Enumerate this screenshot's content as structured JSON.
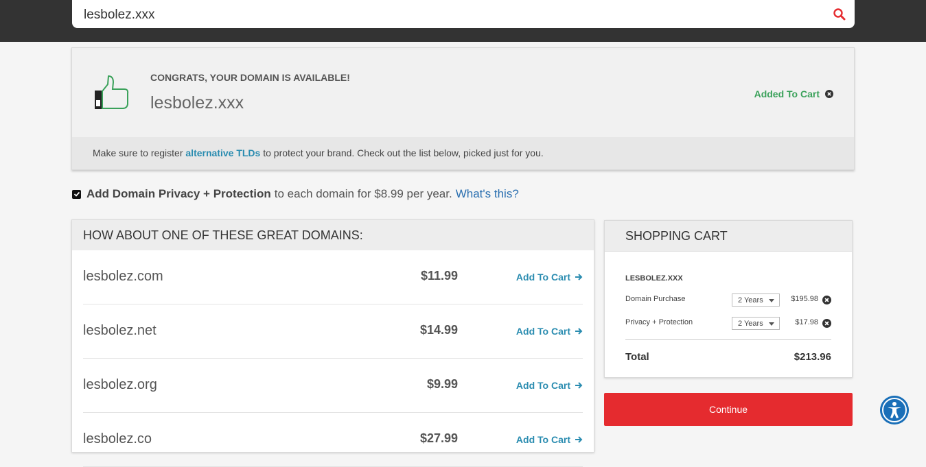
{
  "search": {
    "value": "lesbolez.xxx",
    "icon": "search-icon"
  },
  "congrats": {
    "heading": "CONGRATS, YOUR DOMAIN IS AVAILABLE!",
    "domain": "lesbolez.xxx",
    "added_label": "Added To Cart",
    "note_before": "Make sure to register ",
    "note_link": "alternative TLDs",
    "note_after": " to protect your brand. Check out the list below, picked just for you."
  },
  "privacy": {
    "checked": true,
    "bold": "Add Domain Privacy + Protection",
    "text": "to each domain for $8.99 per year.",
    "link": "What's this?"
  },
  "suggestions": {
    "title": "HOW ABOUT ONE OF THESE GREAT DOMAINS:",
    "add_label": "Add To Cart",
    "items": [
      {
        "name": "lesbolez.com",
        "price": "$11.99"
      },
      {
        "name": "lesbolez.net",
        "price": "$14.99"
      },
      {
        "name": "lesbolez.org",
        "price": "$9.99"
      },
      {
        "name": "lesbolez.co",
        "price": "$27.99"
      }
    ]
  },
  "cart": {
    "title": "SHOPPING CART",
    "domain": "LESBOLEZ.XXX",
    "lines": [
      {
        "label": "Domain Purchase",
        "term": "2 Years",
        "amount": "$195.98"
      },
      {
        "label": "Privacy + Protection",
        "term": "2 Years",
        "amount": "$17.98"
      }
    ],
    "total_label": "Total",
    "total_value": "$213.96"
  },
  "continue_label": "Continue",
  "colors": {
    "topbar": "#333333",
    "accent_red": "#e52b2f",
    "link_blue": "#2a8cb0",
    "success_green": "#3aa15a",
    "accessibility_blue": "#1a6fb8"
  }
}
